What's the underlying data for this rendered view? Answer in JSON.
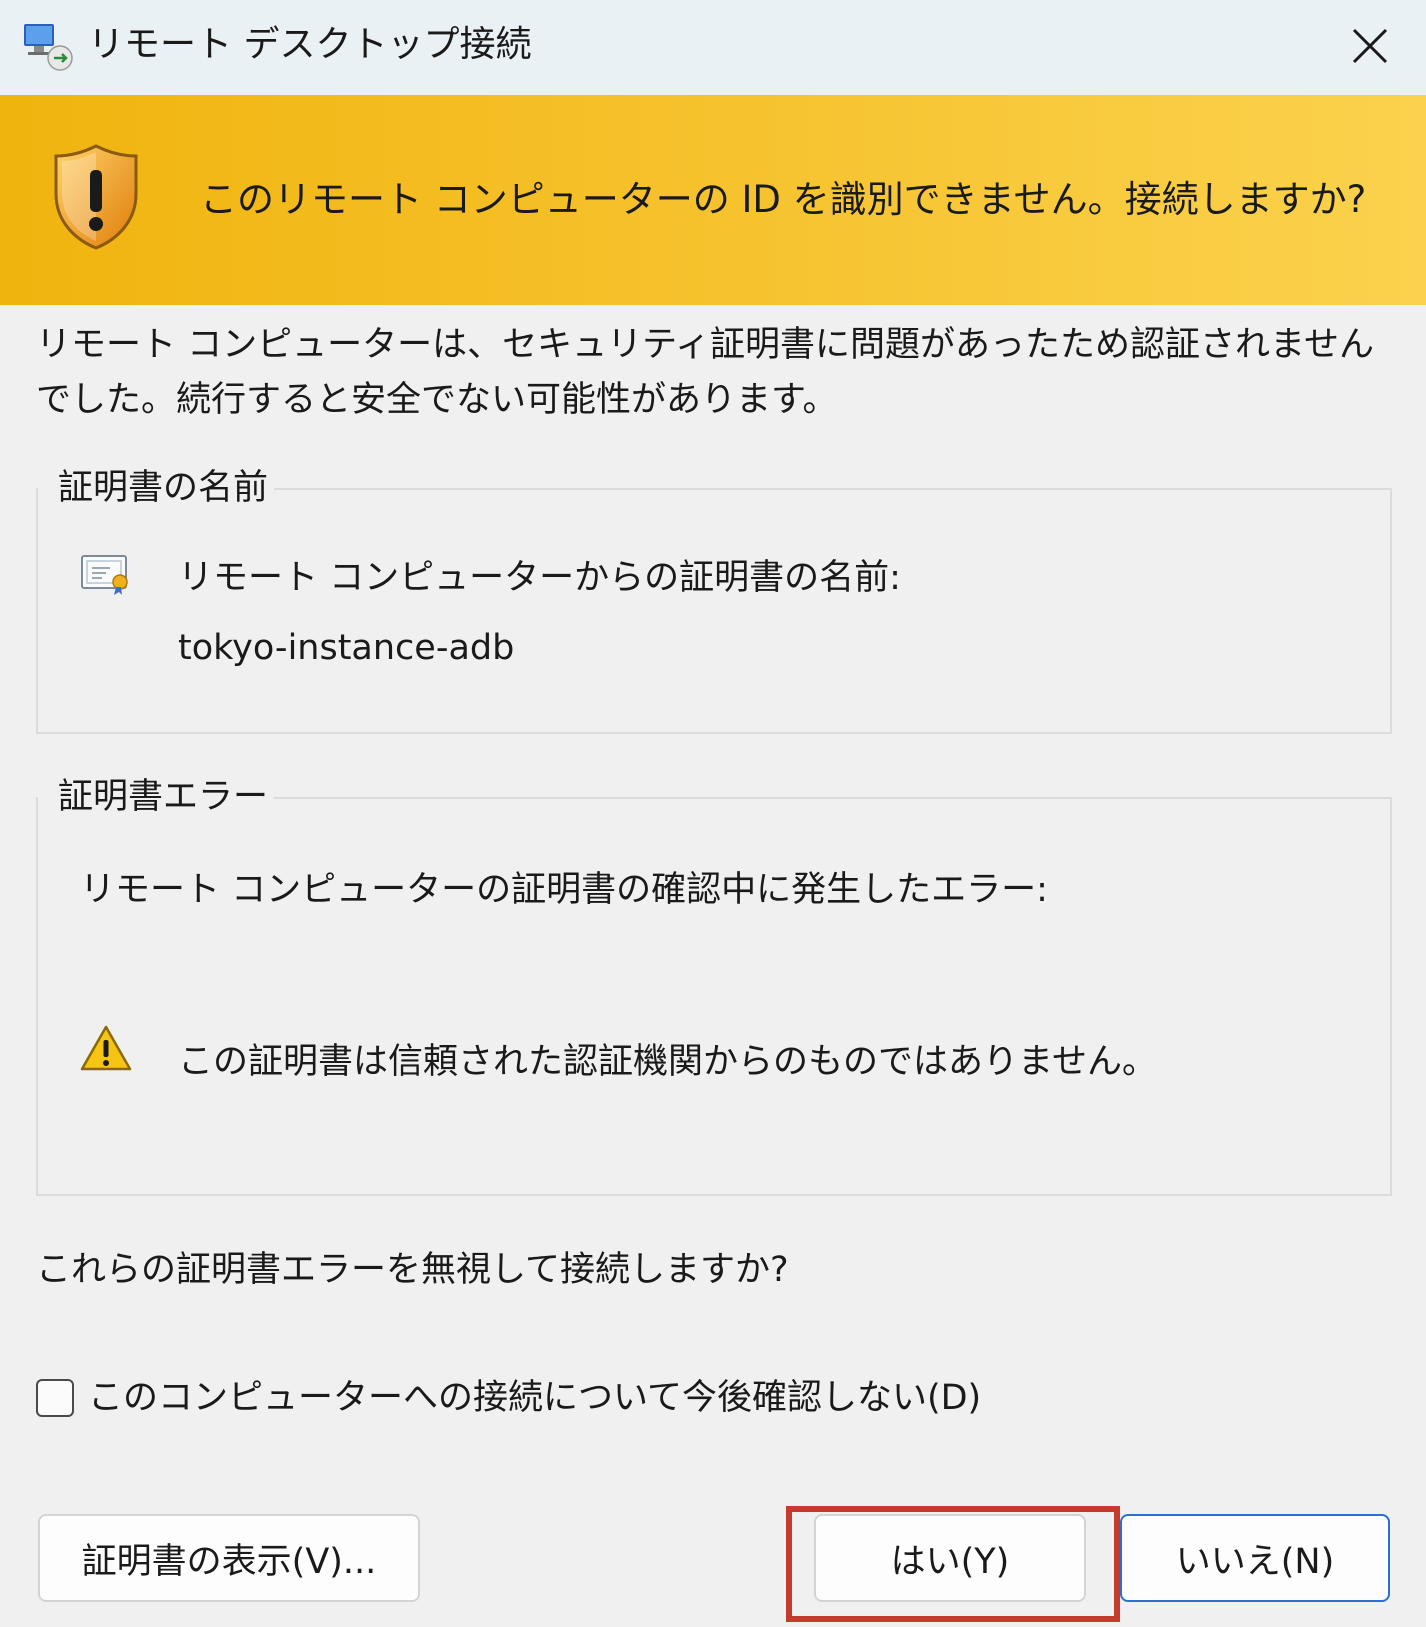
{
  "window": {
    "title": "リモート デスクトップ接続",
    "app_icon": "remote-desktop-icon",
    "close_icon": "close-icon"
  },
  "banner": {
    "icon": "shield-warning-icon",
    "text": "このリモート コンピューターの ID を識別できません。接続しますか?",
    "colors": {
      "start": "#f0b40e",
      "end": "#fbd24d"
    }
  },
  "description": "リモート コンピューターは、セキュリティ証明書に問題があったため認証されませんでした。続行すると安全でない可能性があります。",
  "cert_name_group": {
    "label": "証明書の名前",
    "icon": "certificate-icon",
    "line1": "リモート コンピューターからの証明書の名前:",
    "line2": "tokyo-instance-adb"
  },
  "cert_error_group": {
    "label": "証明書エラー",
    "intro": "リモート コンピューターの証明書の確認中に発生したエラー:",
    "icon": "warning-triangle-icon",
    "message": "この証明書は信頼された認証機関からのものではありません。"
  },
  "question": "これらの証明書エラーを無視して接続しますか?",
  "checkbox": {
    "label": "このコンピューターへの接続について今後確認しない(D)",
    "checked": false
  },
  "buttons": {
    "view_cert": "証明書の表示(V)...",
    "yes": "はい(Y)",
    "no": "いいえ(N)"
  },
  "highlight_color": "#c43a2c"
}
